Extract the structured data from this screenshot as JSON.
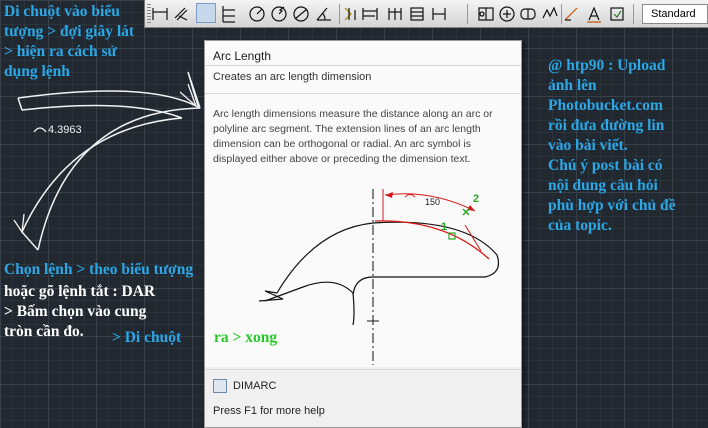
{
  "toolbar": {
    "style_combo": "Standard",
    "icons": [
      "linear-dimension-icon",
      "aligned-dimension-icon",
      "arc-length-icon",
      "ordinate-dimension-icon",
      "radius-dimension-icon",
      "jogged-dimension-icon",
      "diameter-dimension-icon",
      "angular-dimension-icon",
      "quick-dimension-icon",
      "baseline-dimension-icon",
      "continue-dimension-icon",
      "dimension-space-icon",
      "dimension-break-icon",
      "tolerance-icon",
      "center-mark-icon",
      "inspection-icon",
      "jogged-linear-icon",
      "dimension-edit-icon",
      "dimension-text-edit-icon",
      "dimension-update-icon"
    ]
  },
  "tooltip": {
    "title": "Arc Length",
    "subtitle": "Creates an arc length dimension",
    "description": "Arc length dimensions measure the distance along an arc or polyline arc segment. The extension lines of an arc length dimension can be orthogonal or radial. An arc symbol is displayed either above or preceding the dimension text.",
    "illustration": {
      "dim_value": "150",
      "marker_1": "1",
      "marker_2": "2"
    },
    "command": "DIMARC",
    "help": "Press F1 for more help"
  },
  "drawing": {
    "dimension_text": "4.3963"
  },
  "annotations": {
    "top_left": [
      "Di chuột vào biểu",
      "tượng > đợi giây lát",
      "> hiện ra cách sử",
      "dụng lệnh"
    ],
    "bottom_left_cyan": "Chọn lệnh > theo biểu tượng",
    "bottom_left_white": [
      "hoặc gõ lệnh tắt : DAR",
      "> Bấm chọn vào cung",
      "tròn cần đo."
    ],
    "bottom_inline_cyan": ">  Di chuột",
    "bottom_inline_green": "ra > xong",
    "right": [
      "@ htp90 : Upload",
      "ảnh lên",
      "Photobucket.com",
      "rồi đưa đường lin",
      "vào bài viết.",
      "Chú ý post bài có",
      "nội dung câu hỏi",
      "phù hợp với chủ đề",
      "của topic."
    ],
    "colors": {
      "cyan": "#2aa8e8",
      "white": "#ffffff",
      "green": "#28c828",
      "red": "#d81818"
    }
  }
}
